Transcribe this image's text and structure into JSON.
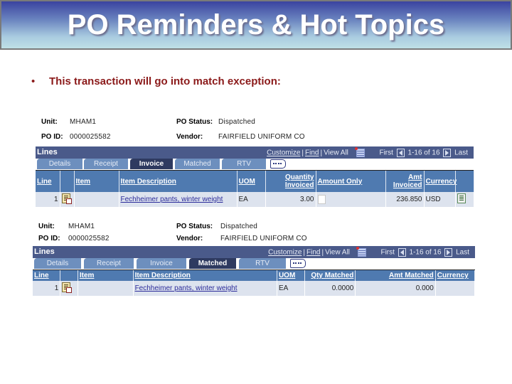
{
  "slide": {
    "title": "PO Reminders & Hot Topics",
    "bullet": "This transaction will go into match exception:",
    "bullet_symbol": "•"
  },
  "colors": {
    "title_text": "#ffffff",
    "bullet_text": "#8b1a1a",
    "lines_bar": "#4a5a8a",
    "column_header": "#4f7ab0",
    "active_tab": "#2e3a60",
    "inactive_tab": "#6d8fbe",
    "row_bg": "#dde3ee"
  },
  "panels": [
    {
      "unit_label": "Unit:",
      "unit_value": "MHAM1",
      "po_id_label": "PO ID:",
      "po_id_value": "0000025582",
      "po_status_label": "PO Status:",
      "po_status_value": "Dispatched",
      "vendor_label": "Vendor:",
      "vendor_value": "FAIRFIELD UNIFORM CO",
      "lines_label": "Lines",
      "nav": {
        "customize": "Customize",
        "find": "Find",
        "view_all": "View All",
        "first": "First",
        "range": "1-16 of 16",
        "last": "Last"
      },
      "tabs": [
        "Details",
        "Receipt",
        "Invoice",
        "Matched",
        "RTV"
      ],
      "active_tab": "Invoice",
      "columns": [
        "Line",
        "",
        "Item",
        "Item Description",
        "UOM",
        "Quantity Invoiced",
        "Amount Only",
        "Amt Invoiced",
        "Currency",
        ""
      ],
      "rows": [
        {
          "line": "1",
          "item": "",
          "description": "Fechheimer pants, winter weight",
          "uom": "EA",
          "qty_invoiced": "3.00",
          "amount_only": false,
          "amt_invoiced": "236.850",
          "currency": "USD"
        }
      ]
    },
    {
      "unit_label": "Unit:",
      "unit_value": "MHAM1",
      "po_id_label": "PO ID:",
      "po_id_value": "0000025582",
      "po_status_label": "PO Status:",
      "po_status_value": "Dispatched",
      "vendor_label": "Vendor:",
      "vendor_value": "FAIRFIELD UNIFORM CO",
      "lines_label": "Lines",
      "nav": {
        "customize": "Customize",
        "find": "Find",
        "view_all": "View All",
        "first": "First",
        "range": "1-16 of 16",
        "last": "Last"
      },
      "tabs": [
        "Details",
        "Receipt",
        "Invoice",
        "Matched",
        "RTV"
      ],
      "active_tab": "Matched",
      "columns": [
        "Line",
        "",
        "Item",
        "Item Description",
        "UOM",
        "Qty Matched",
        "Amt Matched",
        "Currency"
      ],
      "rows": [
        {
          "line": "1",
          "item": "",
          "description": "Fechheimer pants, winter weight",
          "uom": "EA",
          "qty_matched": "0.0000",
          "amt_matched": "0.000",
          "currency": ""
        }
      ]
    }
  ]
}
